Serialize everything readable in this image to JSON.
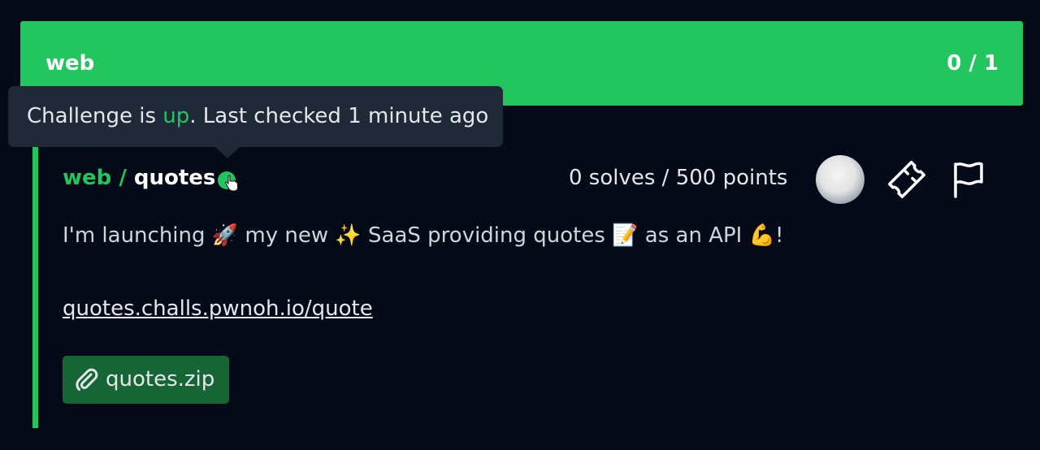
{
  "category": {
    "name": "web",
    "progress": "0 / 1"
  },
  "tooltip": {
    "prefix": "Challenge is ",
    "status": "up",
    "suffix": ". Last checked 1 minute ago"
  },
  "challenge": {
    "category": "web",
    "separator": " / ",
    "name": "quotes",
    "stats": "0 solves / 500 points",
    "description": "I'm launching 🚀 my new ✨ SaaS providing quotes 📝 as an API 💪!",
    "link": "quotes.challs.pwnoh.io/quote",
    "attachment": "quotes.zip"
  },
  "icons": {
    "status": "status-dot-icon",
    "cursor": "hand-pointer-icon",
    "avatar": "avatar",
    "ticket": "ticket-icon",
    "flag": "flag-icon",
    "attachment": "paperclip-icon"
  },
  "colors": {
    "background": "#050a18",
    "accent": "#22c55e",
    "tooltip": "#1f2937",
    "attachment": "#166534"
  }
}
